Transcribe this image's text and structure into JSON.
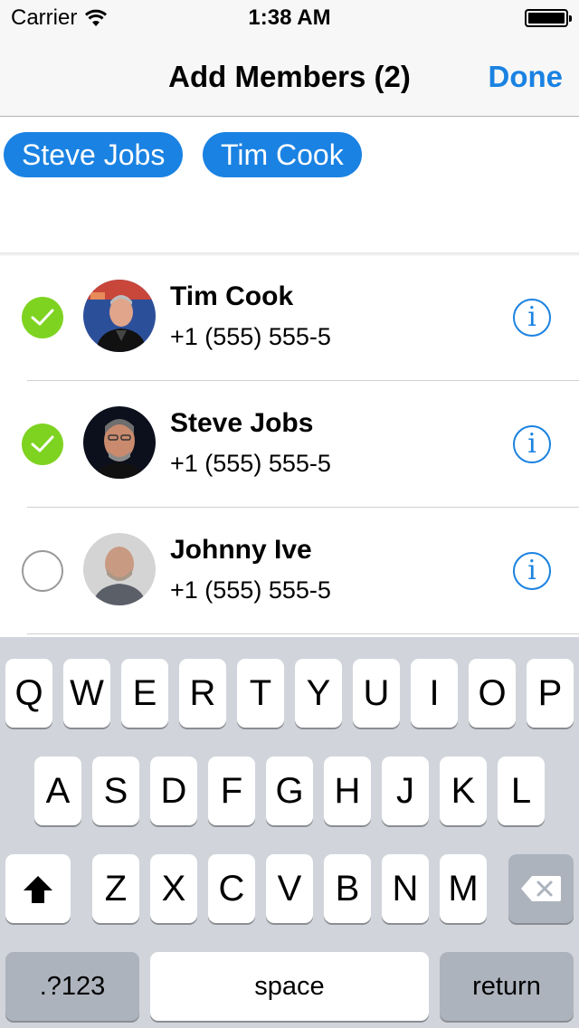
{
  "status_bar": {
    "carrier": "Carrier",
    "time": "1:38 AM",
    "wifi_icon": "wifi-icon",
    "battery_icon": "battery-icon",
    "battery_level": 1.0
  },
  "nav": {
    "title": "Add Members (2)",
    "done_label": "Done"
  },
  "tokens": [
    "Steve Jobs",
    "Tim Cook"
  ],
  "contacts": [
    {
      "name": "Tim Cook",
      "phone": "+1 (555) 555-5",
      "selected": true,
      "info_icon": "info-icon"
    },
    {
      "name": "Steve Jobs",
      "phone": "+1 (555) 555-5",
      "selected": true,
      "info_icon": "info-icon"
    },
    {
      "name": "Johnny Ive",
      "phone": "+1 (555) 555-5",
      "selected": false,
      "info_icon": "info-icon"
    }
  ],
  "keyboard": {
    "row1": [
      "Q",
      "W",
      "E",
      "R",
      "T",
      "Y",
      "U",
      "I",
      "O",
      "P"
    ],
    "row2": [
      "A",
      "S",
      "D",
      "F",
      "G",
      "H",
      "J",
      "K",
      "L"
    ],
    "row3": [
      "Z",
      "X",
      "C",
      "V",
      "B",
      "N",
      "M"
    ],
    "shift_icon": "shift-icon",
    "delete_icon": "backspace-icon",
    "numbers_label": ".?123",
    "space_label": "space",
    "return_label": "return"
  },
  "colors": {
    "accent": "#1a82e2",
    "check_on": "#7ed321",
    "keyboard_bg": "#d1d5db"
  },
  "info_glyph": "i"
}
